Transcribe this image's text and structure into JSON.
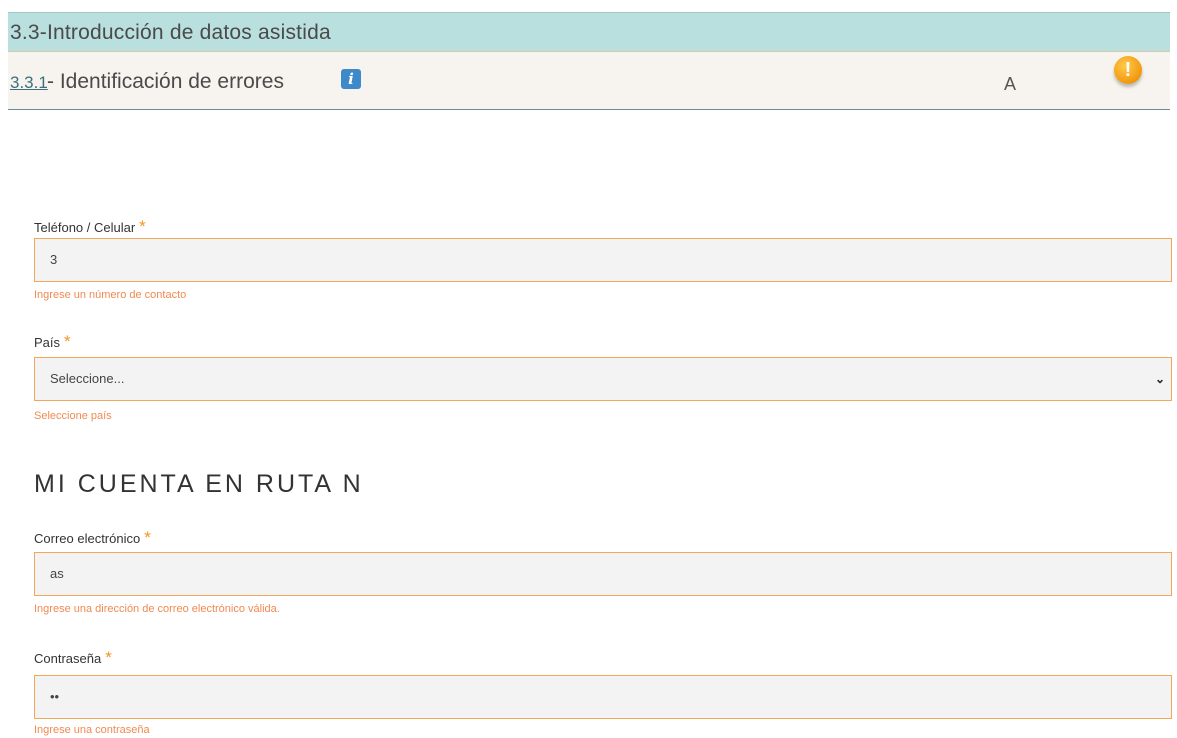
{
  "section": {
    "title": "3.3-Introducción de datos asistida"
  },
  "criterion": {
    "number": "3.3.1",
    "name": "- Identificación de errores",
    "info_icon": "info-icon",
    "level": "A",
    "status_icon": "warning-icon",
    "status_color": "#f39c12"
  },
  "form": {
    "phone": {
      "label": "Teléfono / Celular",
      "required_mark": "*",
      "value": "3",
      "error": "Ingrese un número de contacto"
    },
    "country": {
      "label": "País",
      "required_mark": "*",
      "selected": "Seleccione...",
      "error": "Seleccione país"
    },
    "account_title": "MI CUENTA EN RUTA N",
    "email": {
      "label": "Correo electrónico",
      "required_mark": "*",
      "value": "as",
      "error": "Ingrese una dirección de correo electrónico válida."
    },
    "password": {
      "label": "Contraseña",
      "required_mark": "*",
      "value": "••",
      "error": "Ingrese una contraseña"
    }
  },
  "colors": {
    "header_bg": "#b9dfde",
    "required_mark": "#f7941d",
    "error_text": "#f08a52",
    "field_border": "#f2a75b"
  }
}
